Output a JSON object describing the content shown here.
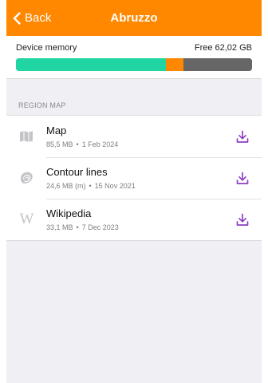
{
  "nav": {
    "back_label": "Back",
    "title": "Abruzzo",
    "background": "#ff8800"
  },
  "memory": {
    "label": "Device memory",
    "free_text": "Free 62,02 GB",
    "segments": [
      {
        "name": "used",
        "fraction": 0.635,
        "color": "#20d5a2"
      },
      {
        "name": "downloads",
        "fraction": 0.075,
        "color": "#ff8800"
      },
      {
        "name": "free",
        "fraction": 0.29,
        "color": "#666666"
      }
    ]
  },
  "section": {
    "header": "REGION MAP",
    "items": [
      {
        "title": "Map",
        "size": "85,5 MB",
        "date": "1 Feb 2024",
        "icon": "map-icon"
      },
      {
        "title": "Contour lines",
        "size": "24,6 MB (m)",
        "date": "15 Nov 2021",
        "icon": "contour-lines-icon"
      },
      {
        "title": "Wikipedia",
        "size": "33,1 MB",
        "date": "7 Dec 2023",
        "icon": "wikipedia-icon",
        "glyph": "W"
      }
    ]
  },
  "colors": {
    "accent": "#ff8800",
    "download_icon": "#8e3fc5",
    "icon_gray": "#c4c4c8"
  }
}
